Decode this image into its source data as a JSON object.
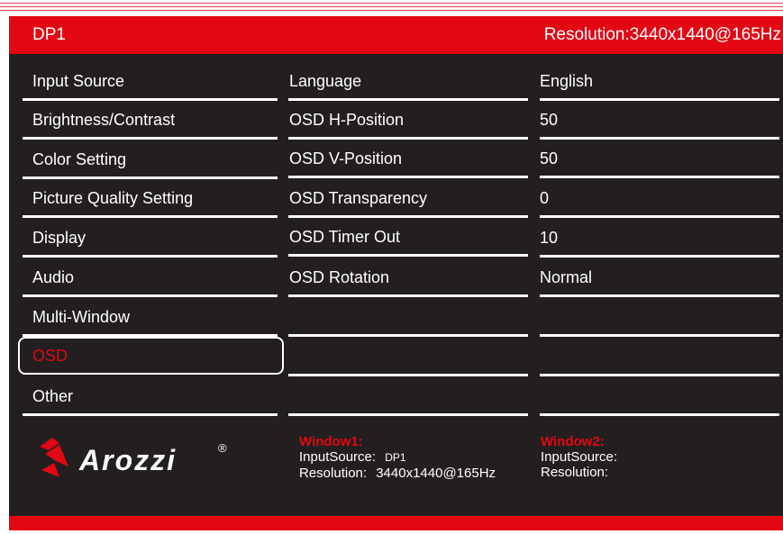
{
  "header": {
    "input_source": "DP1",
    "resolution": "Resolution:3440x1440@165Hz"
  },
  "menu": {
    "items": [
      {
        "label": "Input Source"
      },
      {
        "label": "Brightness/Contrast"
      },
      {
        "label": "Color Setting"
      },
      {
        "label": "Picture Quality Setting"
      },
      {
        "label": "Display"
      },
      {
        "label": "Audio"
      },
      {
        "label": "Multi-Window"
      },
      {
        "label": "OSD"
      },
      {
        "label": "Other"
      }
    ],
    "selected": "OSD"
  },
  "settings": [
    {
      "label": "Language",
      "value": "English"
    },
    {
      "label": "OSD H-Position",
      "value": "50"
    },
    {
      "label": "OSD V-Position",
      "value": "50"
    },
    {
      "label": "OSD Transparency",
      "value": "0"
    },
    {
      "label": "OSD Timer Out",
      "value": "10"
    },
    {
      "label": "OSD Rotation",
      "value": "Normal"
    }
  ],
  "logo": {
    "text": "Arozzi",
    "mark": "®"
  },
  "window1": {
    "title": "Window1:",
    "input_label": "InputSource:",
    "input_value": "DP1",
    "resolution_label": "Resolution:",
    "resolution_value": "3440x1440@165Hz"
  },
  "window2": {
    "title": "Window2:",
    "input_label": "InputSource:",
    "input_value": "",
    "resolution_label": "Resolution:",
    "resolution_value": ""
  },
  "colors": {
    "accent": "#e30613",
    "background": "#231f20",
    "text": "#ffffff"
  }
}
